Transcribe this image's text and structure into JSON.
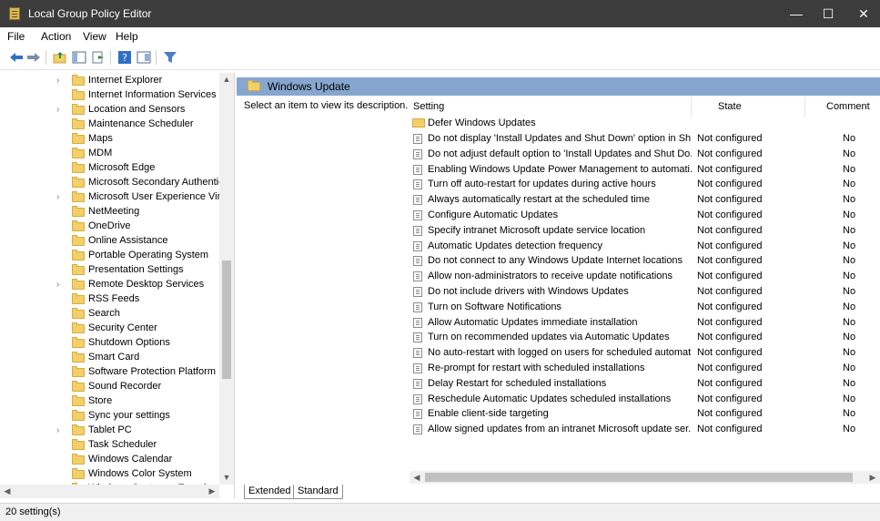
{
  "window": {
    "title": "Local Group Policy Editor",
    "minimize": "—",
    "maximize": "☐",
    "close": "✕"
  },
  "menu": [
    "File",
    "Action",
    "View",
    "Help"
  ],
  "tree": {
    "items": [
      {
        "label": "Internet Explorer",
        "expandable": true
      },
      {
        "label": "Internet Information Services",
        "expandable": false
      },
      {
        "label": "Location and Sensors",
        "expandable": true
      },
      {
        "label": "Maintenance Scheduler",
        "expandable": false
      },
      {
        "label": "Maps",
        "expandable": false
      },
      {
        "label": "MDM",
        "expandable": false
      },
      {
        "label": "Microsoft Edge",
        "expandable": false
      },
      {
        "label": "Microsoft Secondary Authentic",
        "expandable": false
      },
      {
        "label": "Microsoft User Experience Virtu",
        "expandable": true
      },
      {
        "label": "NetMeeting",
        "expandable": false
      },
      {
        "label": "OneDrive",
        "expandable": false
      },
      {
        "label": "Online Assistance",
        "expandable": false
      },
      {
        "label": "Portable Operating System",
        "expandable": false
      },
      {
        "label": "Presentation Settings",
        "expandable": false
      },
      {
        "label": "Remote Desktop Services",
        "expandable": true
      },
      {
        "label": "RSS Feeds",
        "expandable": false
      },
      {
        "label": "Search",
        "expandable": false
      },
      {
        "label": "Security Center",
        "expandable": false
      },
      {
        "label": "Shutdown Options",
        "expandable": false
      },
      {
        "label": "Smart Card",
        "expandable": false
      },
      {
        "label": "Software Protection Platform",
        "expandable": false
      },
      {
        "label": "Sound Recorder",
        "expandable": false
      },
      {
        "label": "Store",
        "expandable": false
      },
      {
        "label": "Sync your settings",
        "expandable": false
      },
      {
        "label": "Tablet PC",
        "expandable": true
      },
      {
        "label": "Task Scheduler",
        "expandable": false
      },
      {
        "label": "Windows Calendar",
        "expandable": false
      },
      {
        "label": "Windows Color System",
        "expandable": false
      },
      {
        "label": "Windows Customer Experienc",
        "expandable": false
      }
    ]
  },
  "right": {
    "header_title": "Windows Update",
    "description": "Select an item to view its description.",
    "columns": {
      "setting": "Setting",
      "state": "State",
      "comment": "Comment"
    },
    "folder_row": "Defer Windows Updates",
    "rows": [
      {
        "setting": "Do not display 'Install Updates and Shut Down' option in Sh...",
        "state": "Not configured",
        "comment": "No"
      },
      {
        "setting": "Do not adjust default option to 'Install Updates and Shut Do...",
        "state": "Not configured",
        "comment": "No"
      },
      {
        "setting": "Enabling Windows Update Power Management to automati...",
        "state": "Not configured",
        "comment": "No"
      },
      {
        "setting": "Turn off auto-restart for updates during active hours",
        "state": "Not configured",
        "comment": "No"
      },
      {
        "setting": "Always automatically restart at the scheduled time",
        "state": "Not configured",
        "comment": "No"
      },
      {
        "setting": "Configure Automatic Updates",
        "state": "Not configured",
        "comment": "No"
      },
      {
        "setting": "Specify intranet Microsoft update service location",
        "state": "Not configured",
        "comment": "No"
      },
      {
        "setting": "Automatic Updates detection frequency",
        "state": "Not configured",
        "comment": "No"
      },
      {
        "setting": "Do not connect to any Windows Update Internet locations",
        "state": "Not configured",
        "comment": "No"
      },
      {
        "setting": "Allow non-administrators to receive update notifications",
        "state": "Not configured",
        "comment": "No"
      },
      {
        "setting": "Do not include drivers with Windows Updates",
        "state": "Not configured",
        "comment": "No"
      },
      {
        "setting": "Turn on Software Notifications",
        "state": "Not configured",
        "comment": "No"
      },
      {
        "setting": "Allow Automatic Updates immediate installation",
        "state": "Not configured",
        "comment": "No"
      },
      {
        "setting": "Turn on recommended updates via Automatic Updates",
        "state": "Not configured",
        "comment": "No"
      },
      {
        "setting": "No auto-restart with logged on users for scheduled automat...",
        "state": "Not configured",
        "comment": "No"
      },
      {
        "setting": "Re-prompt for restart with scheduled installations",
        "state": "Not configured",
        "comment": "No"
      },
      {
        "setting": "Delay Restart for scheduled installations",
        "state": "Not configured",
        "comment": "No"
      },
      {
        "setting": "Reschedule Automatic Updates scheduled installations",
        "state": "Not configured",
        "comment": "No"
      },
      {
        "setting": "Enable client-side targeting",
        "state": "Not configured",
        "comment": "No"
      },
      {
        "setting": "Allow signed updates from an intranet Microsoft update ser...",
        "state": "Not configured",
        "comment": "No"
      }
    ]
  },
  "tabs": [
    "Extended",
    "Standard"
  ],
  "status": "20 setting(s)",
  "colors": {
    "titlebar": "#3c3c3c",
    "header": "#86a6cf",
    "folder": "#f2cf6a"
  }
}
